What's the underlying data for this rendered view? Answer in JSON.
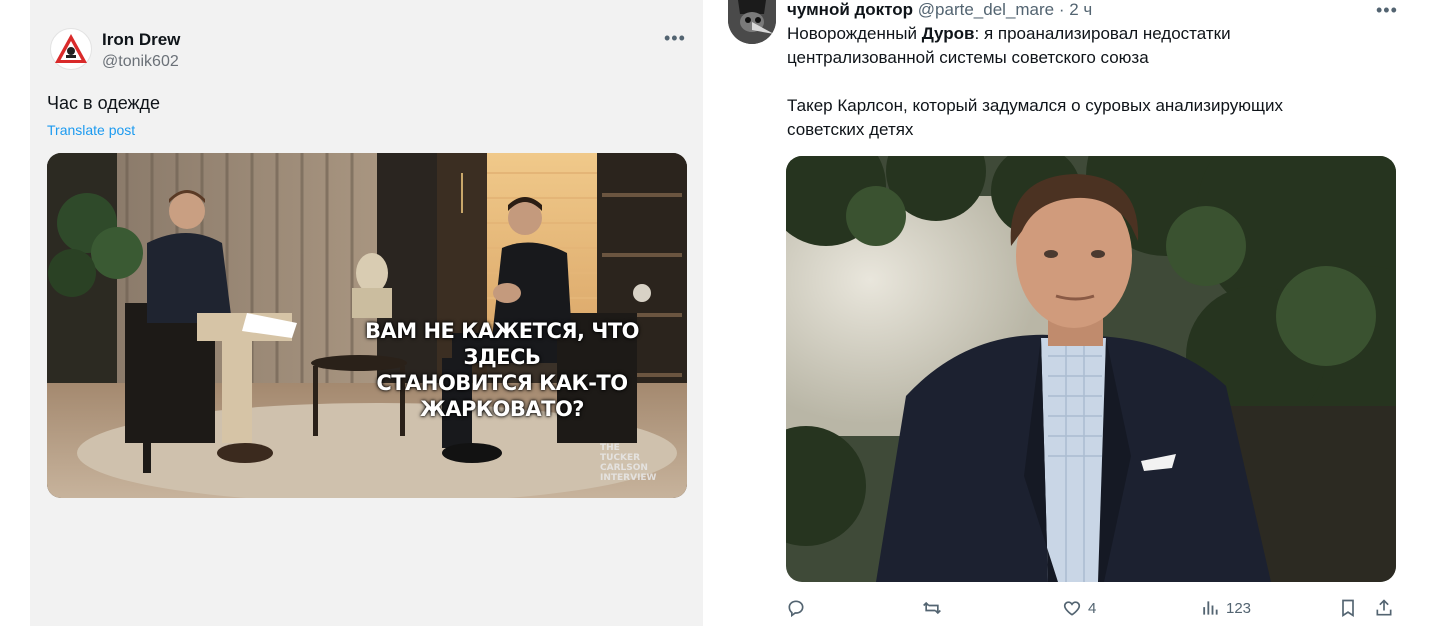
{
  "left_tweet": {
    "author_name": "Iron Drew",
    "handle": "@tonik602",
    "text": "Час в одежде",
    "translate_label": "Translate post",
    "media": {
      "caption_lines": [
        "ВАМ НЕ КАЖЕТСЯ, ЧТО ЗДЕСЬ",
        "СТАНОВИТСЯ КАК-ТО",
        "ЖАРКОВАТО?"
      ],
      "watermark_lines": [
        "THE",
        "TUCKER",
        "CARLSON",
        "INTERVIEW"
      ]
    }
  },
  "right_tweet": {
    "author_name": "чумной доктор",
    "handle": "@parte_del_mare",
    "time": "· 2 ч",
    "text_line1_prefix": "Новорожденный ",
    "text_line1_bold": "Дуров",
    "text_line1_suffix": ": я проанализировал недостатки",
    "text_line2": "централизованной системы советского союза",
    "text_line3": "Такер Карлсон, который задумался о суровых анализирующих",
    "text_line4": "советских детях",
    "actions": {
      "reply_count": "",
      "retweet_count": "",
      "like_count": "4",
      "view_count": "123"
    }
  },
  "colors": {
    "left_bg": "#f2f2f2",
    "link_blue": "#1d9bf0",
    "muted": "#536471"
  },
  "icons": [
    "warning-triangle-icon",
    "more-icon",
    "reply-icon",
    "retweet-icon",
    "like-icon",
    "views-icon",
    "bookmark-icon",
    "share-icon"
  ]
}
